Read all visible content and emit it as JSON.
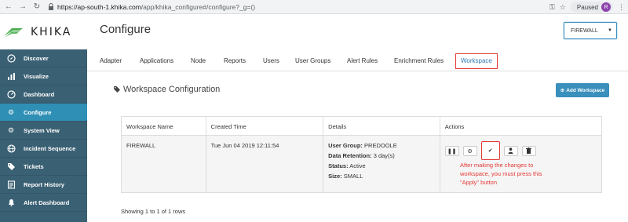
{
  "browser": {
    "url_host": "https://ap-south-1.khika.com",
    "url_path": "/app/khika_configure#/configure?_g=()",
    "paused_label": "Paused",
    "avatar_letter": "R"
  },
  "logo": {
    "text": "KHIKA"
  },
  "sidebar": {
    "items": [
      {
        "label": "Discover",
        "icon": "compass-icon"
      },
      {
        "label": "Visualize",
        "icon": "bar-chart-icon"
      },
      {
        "label": "Dashboard",
        "icon": "dashboard-icon"
      },
      {
        "label": "Configure",
        "icon": "gear-icon",
        "active": true
      },
      {
        "label": "System View",
        "icon": "gears-icon"
      },
      {
        "label": "Incident Sequence",
        "icon": "globe-icon"
      },
      {
        "label": "Tickets",
        "icon": "tags-icon"
      },
      {
        "label": "Report History",
        "icon": "report-icon"
      },
      {
        "label": "Alert Dashboard",
        "icon": "bell-icon"
      }
    ]
  },
  "page": {
    "title": "Configure",
    "workspace_select": "FIREWALL",
    "tabs": [
      "Adapter",
      "Applications",
      "Node",
      "Reports",
      "Users",
      "User Groups",
      "Alert Rules",
      "Enrichment Rules",
      "Workspace"
    ],
    "active_tab": "Workspace",
    "section_title": "Workspace Configuration",
    "add_button": "Add Workspace"
  },
  "table": {
    "headers": [
      "Workspace Name",
      "Created Time",
      "Details",
      "Actions"
    ],
    "rows": [
      {
        "name": "FIREWALL",
        "created": "Tue Jun 04 2019 12:11:54",
        "details": [
          {
            "key": "User Group:",
            "value": "PREDOOLE"
          },
          {
            "key": "Data Retention:",
            "value": "3 day(s)"
          },
          {
            "key": "Status:",
            "value": "Active"
          },
          {
            "key": "Size:",
            "value": "SMALL"
          }
        ]
      }
    ]
  },
  "annotation": "After making the changes to workspace, you must press this \"Apply\" button",
  "footer": "Showing 1 to 1 of 1 rows",
  "colors": {
    "sidebar_bg": "#3a6073",
    "sidebar_active": "#2f8fb5",
    "primary_button": "#3a8fbc",
    "highlight_red": "#e53935"
  }
}
